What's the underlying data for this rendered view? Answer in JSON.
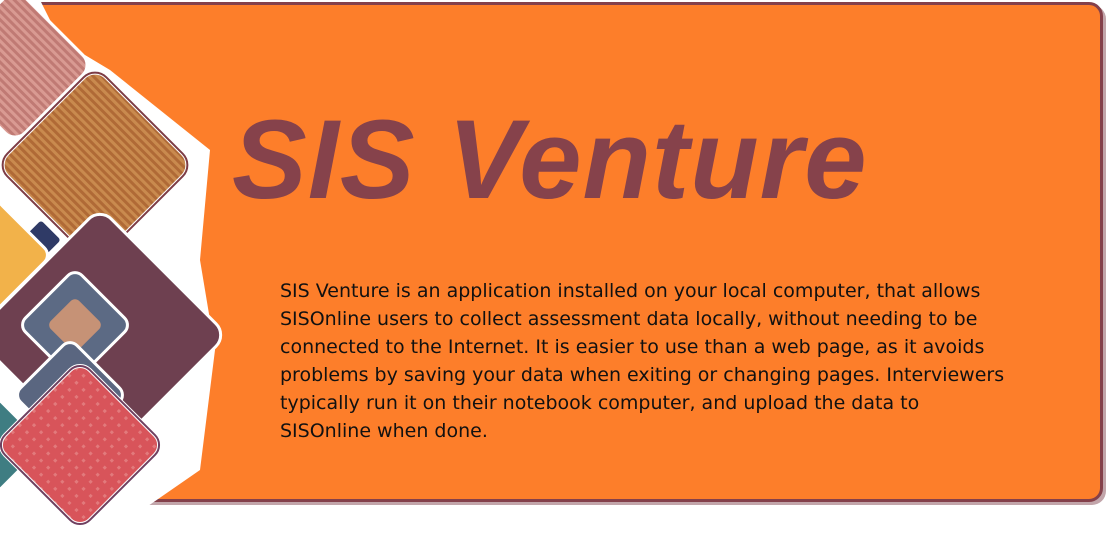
{
  "banner": {
    "title": "SIS Venture",
    "description_lines": [
      "SIS Venture is an application installed on your local computer, that allows",
      "SISOnline users to collect assessment data locally, without needing to be",
      "connected to the Internet.  It is easier to use than a web page, as it avoids",
      "problems by saving your data when exiting or changing pages.  Interviewers",
      "typically run it on their notebook computer, and upload the data to",
      "SISOnline when done."
    ]
  },
  "colors": {
    "panel": "#fd7e2a",
    "title": "#86424b",
    "border": "#84404a",
    "text": "#111111"
  }
}
